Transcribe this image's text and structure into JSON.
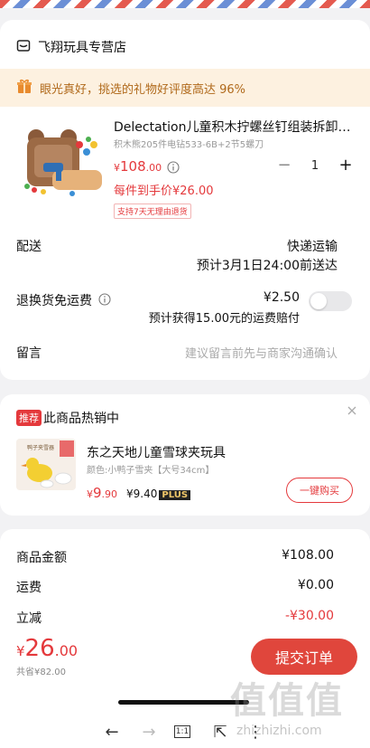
{
  "store": {
    "name": "飞翔玩具专营店",
    "icon": "store-icon"
  },
  "banner": {
    "icon": "gift-icon",
    "text": "眼光真好，挑选的礼物好评度高达 96%"
  },
  "product": {
    "title": "Delectation儿童积木拧螺丝钉组装拆卸…",
    "sku": "积木熊205件电钻533-6B+2节5螺刀",
    "price_symbol": "¥",
    "price_int": "108",
    "price_dec": ".00",
    "unit_price": "每件到手价¥26.00",
    "tag": "支持7天无理由退货",
    "quantity": "1",
    "minus": "−",
    "plus": "+"
  },
  "delivery": {
    "label": "配送",
    "method": "快递运输",
    "eta": "预计3月1日24:00前送达"
  },
  "return_insurance": {
    "label": "退换货免运费",
    "price": "¥2.50",
    "desc": "预计获得15.00元的运费赔付",
    "enabled": false
  },
  "message": {
    "label": "留言",
    "placeholder": "建议留言前先与商家沟通确认"
  },
  "recommend": {
    "badge": "推荐",
    "heading": "此商品热销中",
    "thumb_text": "鸭子夹雪器",
    "title": "东之天地儿童雪球夹玩具",
    "variant": "颜色:小鸭子雪夹【大号34cm】",
    "price_symbol": "¥",
    "price_int": "9",
    "price_dec": ".90",
    "plus_price": "¥9.40",
    "plus_label": "PLUS",
    "buy_label": "一键购买"
  },
  "summary": {
    "rows": [
      {
        "label": "商品金额",
        "value": "¥108.00"
      },
      {
        "label": "运费",
        "value": "¥0.00"
      },
      {
        "label": "立减",
        "value": "-¥30.00"
      }
    ]
  },
  "footer": {
    "total_symbol": "¥",
    "total_int": "26",
    "total_dec": ".00",
    "saved": "共省¥82.00",
    "submit_label": "提交订单"
  },
  "browser_nav": {
    "back": "←",
    "forward": "→",
    "zoom": "1:1",
    "share": "⇱",
    "menu": "⋮"
  },
  "watermark": {
    "text": "值值值",
    "url": "zhizhizhi.com"
  },
  "colors": {
    "accent": "#e4393c",
    "banner_bg": "#fdf1e0",
    "banner_text": "#b0691a"
  }
}
